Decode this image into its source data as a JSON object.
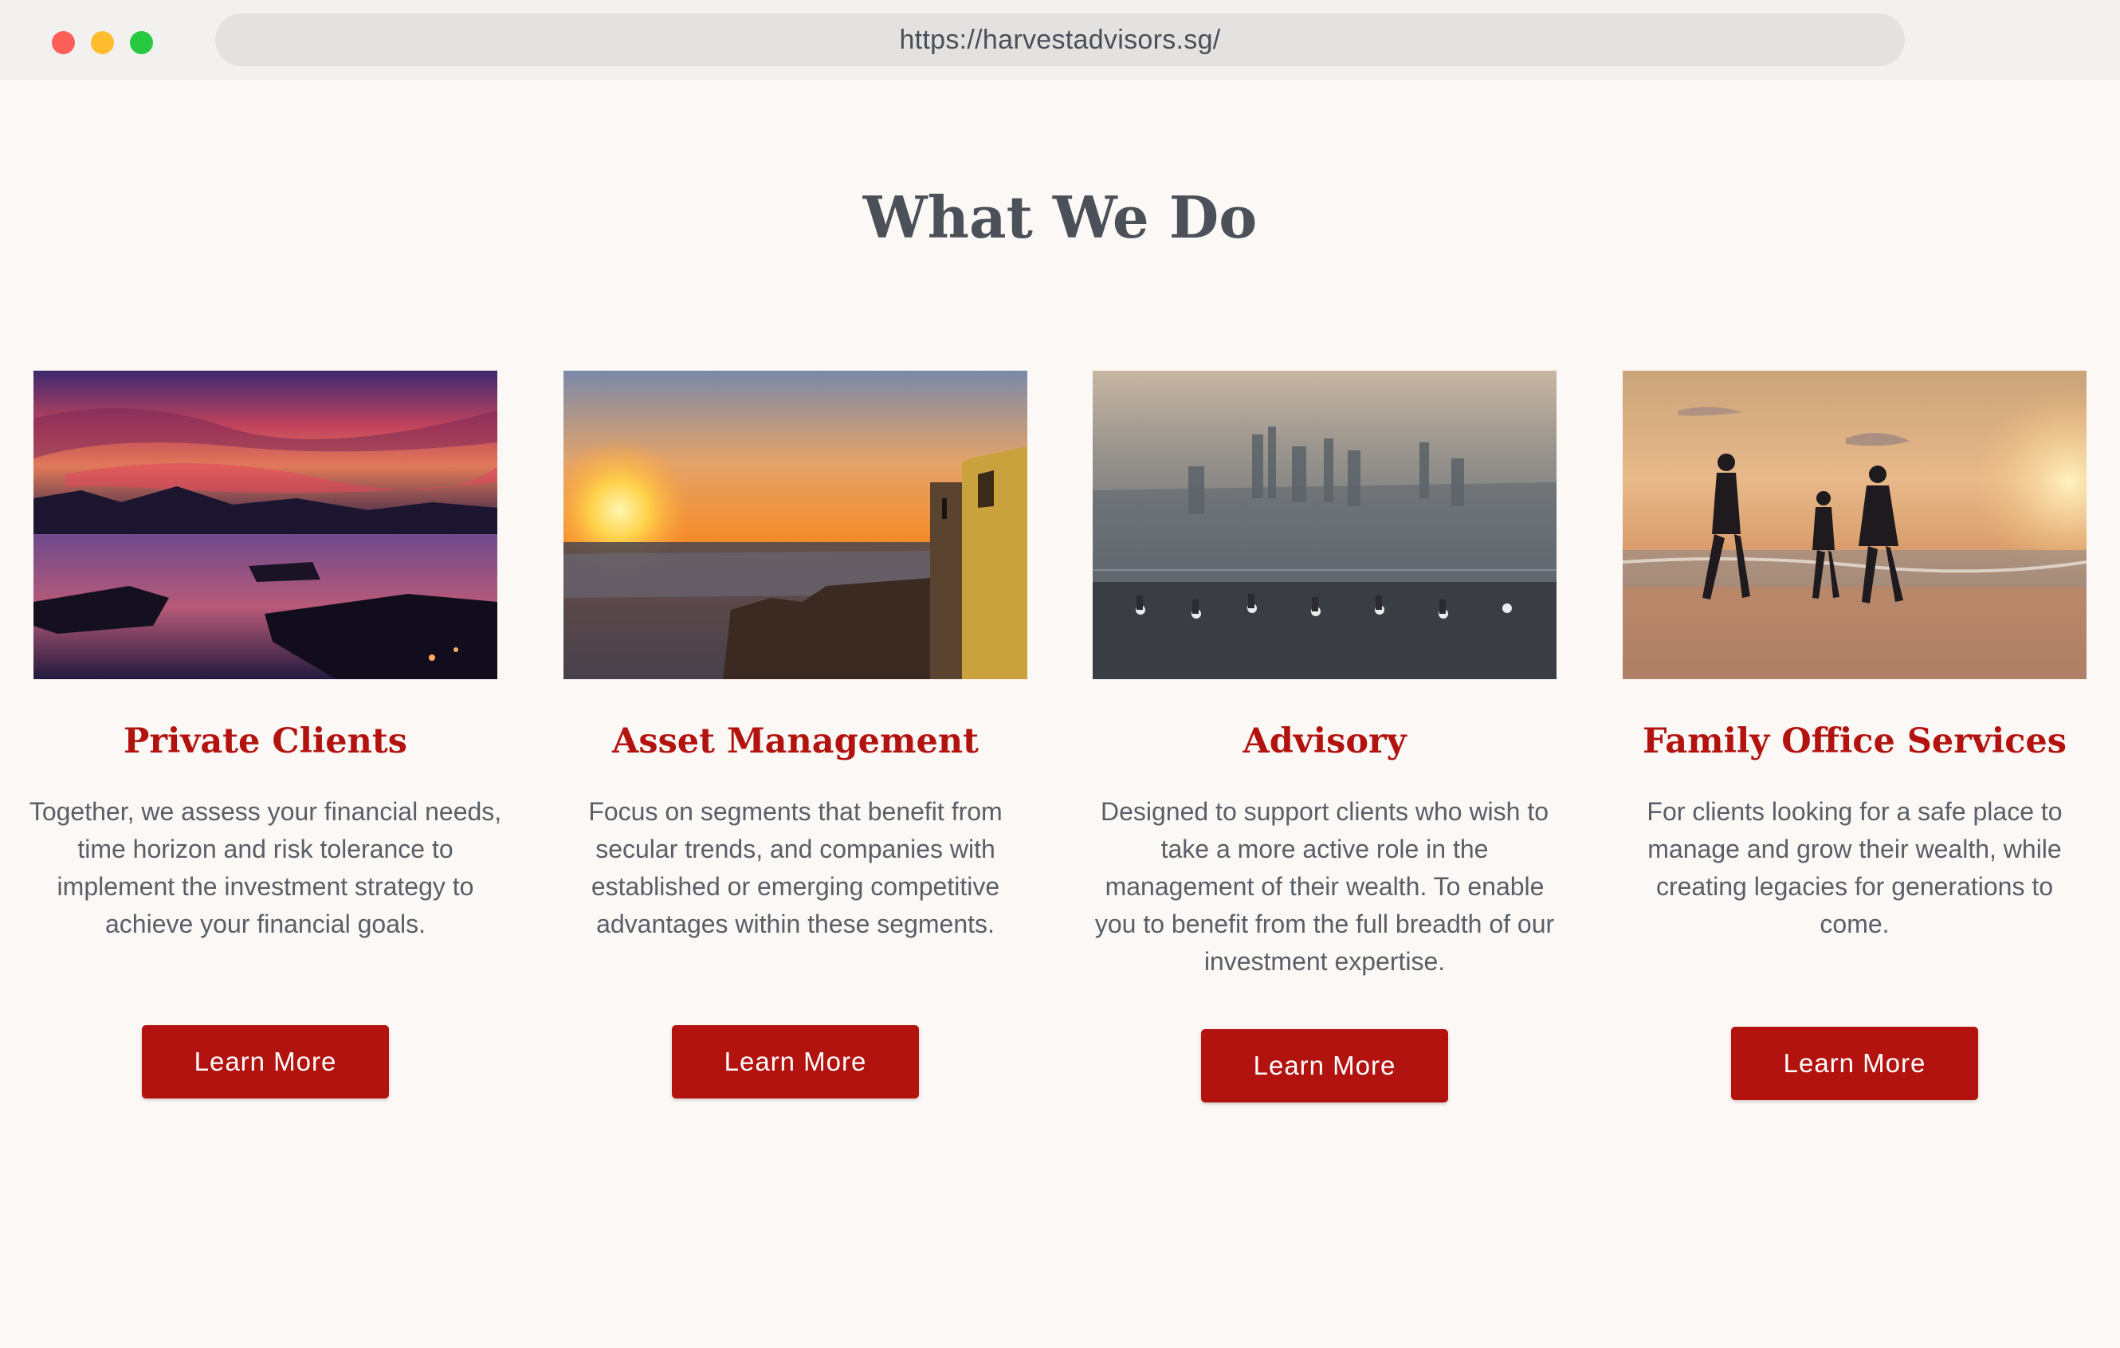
{
  "browser": {
    "url": "https://harvestadvisors.sg/"
  },
  "section": {
    "title": "What We Do"
  },
  "cards": [
    {
      "image": "sunset-harbor-photo",
      "title": "Private Clients",
      "text": "Together, we assess your financial needs, time horizon and risk tolerance to implement the investment strategy to achieve your financial goals.",
      "button": "Learn More"
    },
    {
      "image": "sunset-city-fort-photo",
      "title": "Asset Management",
      "text": "Focus on segments that benefit from secular trends, and companies with established or emerging competitive advantages within these segments.",
      "button": "Learn More"
    },
    {
      "image": "skyscraper-observation-deck-photo",
      "title": "Advisory",
      "text": "Designed to support clients who wish to take a more active role in the management of their wealth. To enable you to benefit from the full breadth of our investment expertise.",
      "button": "Learn More"
    },
    {
      "image": "family-beach-sunset-photo",
      "title": "Family Office Services",
      "text": "For clients looking for a safe place to manage and grow their wealth, while creating legacies for generations to come.",
      "button": "Learn More"
    }
  ],
  "colors": {
    "accent": "#b3130f",
    "heading": "#4c5058",
    "body_text": "#5a5e66",
    "background": "#fbf8f6"
  }
}
